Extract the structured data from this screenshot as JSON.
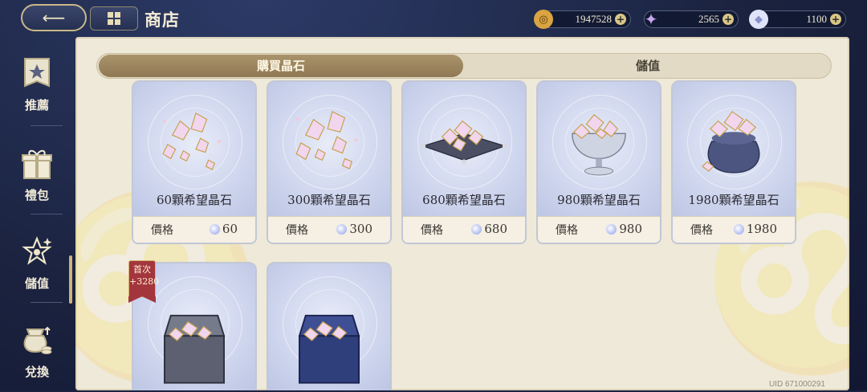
{
  "header": {
    "title": "商店",
    "currencies": [
      {
        "name": "gold-coin",
        "value": "1947528",
        "color": "#d9a441"
      },
      {
        "name": "crystal",
        "value": "2565",
        "color": "#b69ae6"
      },
      {
        "name": "wish-gem",
        "value": "1100",
        "color": "#c8d1f5"
      }
    ]
  },
  "sidebar": {
    "items": [
      {
        "label": "推薦",
        "icon": "star-banner-icon"
      },
      {
        "label": "禮包",
        "icon": "gift-box-icon"
      },
      {
        "label": "儲值",
        "icon": "sparkle-star-icon",
        "active": true
      },
      {
        "label": "兌換",
        "icon": "money-bag-icon"
      }
    ]
  },
  "tabs": [
    {
      "label": "購買晶石",
      "active": true
    },
    {
      "label": "儲值",
      "active": false
    }
  ],
  "products": [
    {
      "name": "60顆希望晶石",
      "price_label": "價格",
      "price": "60"
    },
    {
      "name": "300顆希望晶石",
      "price_label": "價格",
      "price": "300"
    },
    {
      "name": "680顆希望晶石",
      "price_label": "價格",
      "price": "680"
    },
    {
      "name": "980顆希望晶石",
      "price_label": "價格",
      "price": "980"
    },
    {
      "name": "1980顆希望晶石",
      "price_label": "價格",
      "price": "1980"
    }
  ],
  "chests": [
    {
      "badge_line1": "首次",
      "badge_line2": "+3280"
    },
    {}
  ],
  "uid": "UID 671000291"
}
